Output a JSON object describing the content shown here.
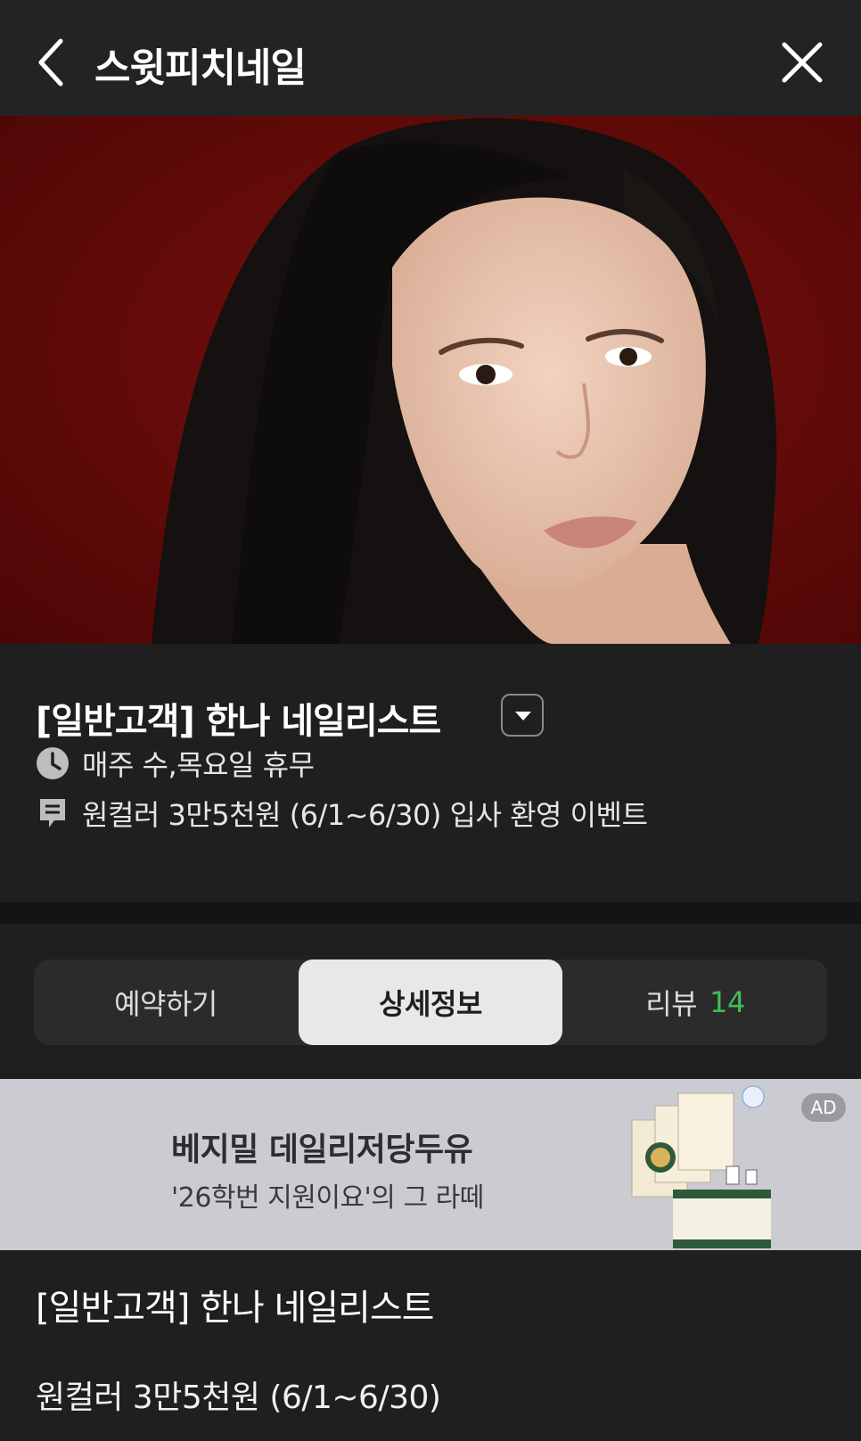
{
  "header": {
    "title": "스윗피치네일"
  },
  "staff": {
    "name": "[일반고객] 한나 네일리스트",
    "closed_days": "매주 수,목요일 휴무",
    "notice": "원컬러 3만5천원 (6/1~6/30) 입사 환영 이벤트"
  },
  "tabs": [
    {
      "label": "예약하기"
    },
    {
      "label": "상세정보",
      "active": true
    },
    {
      "label": "리뷰",
      "count": "14"
    }
  ],
  "ad": {
    "title": "베지밀 데일리저당두유",
    "subtitle": "'26학번 지원이요'의 그 라떼",
    "badge": "AD"
  },
  "detail": {
    "title": "[일반고객] 한나 네일리스트",
    "text": "원컬러 3만5천원 (6/1~6/30)"
  },
  "colors": {
    "background": "#1f1f1f",
    "review_count": "#3fbf5a",
    "active_tab": "#e8e8e8",
    "ad_background": "#cbcbd2"
  }
}
